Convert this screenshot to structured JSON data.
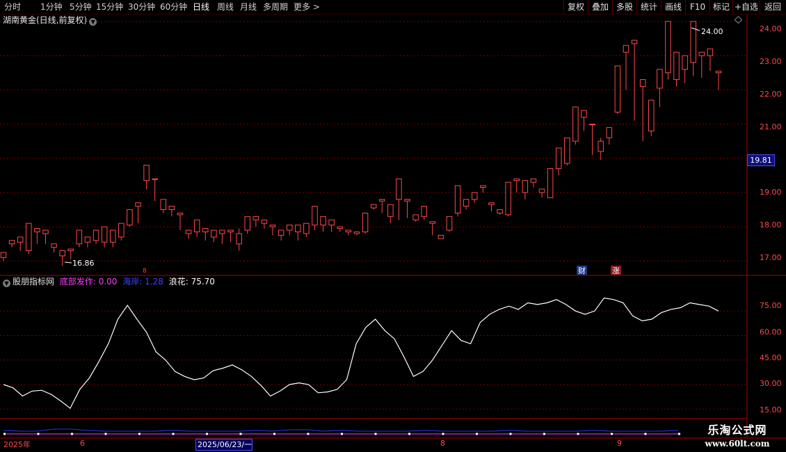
{
  "toolbar": {
    "periods": [
      "分时",
      "1分钟",
      "5分钟",
      "15分钟",
      "30分钟",
      "60分钟",
      "日线",
      "周线",
      "月线",
      "多周期",
      "更多 >"
    ],
    "active_period": "日线",
    "right_buttons": [
      "复权",
      "叠加",
      "多股",
      "统计",
      "画线",
      "F10",
      "标记",
      "+自选",
      "返回"
    ]
  },
  "main_chart": {
    "title": "湖南黄金(日线,前复权)",
    "title_icon": "chevron-down-icon",
    "high_label": "24.00",
    "low_label": "16.86",
    "current_price": "19.81",
    "price_ticks": [
      "24.00",
      "23.00",
      "22.00",
      "21.00",
      "19.00",
      "18.00",
      "17.00"
    ],
    "event_markers": [
      "财",
      "涨"
    ],
    "diamond_icon": "diamond-icon"
  },
  "indicator": {
    "name": "股朋指标网",
    "items": [
      {
        "label": "底部发作:",
        "value": "0.00",
        "color": "#ff40ff"
      },
      {
        "label": "海岸:",
        "value": "1.28",
        "color": "#4040ff"
      },
      {
        "label": "浪花:",
        "value": "75.70",
        "color": "#ffffff"
      }
    ],
    "ticks": [
      "75.00",
      "60.00",
      "45.00",
      "30.00",
      "15.00"
    ]
  },
  "date_axis": {
    "labels": [
      "2025年",
      "6",
      "8",
      "9"
    ],
    "cursor_label": "2025/06/23/一"
  },
  "watermark": {
    "line1": "乐淘公式网",
    "line2": "www.60lt.com"
  },
  "colors": {
    "up": "#ff4a4a",
    "down": "#54ffff",
    "grid": "#7a0000",
    "indicator_line": "#ffffff",
    "coast_line": "#3030ff"
  },
  "chart_data": {
    "type": "candlestick",
    "candles": [
      [
        17.1,
        17.25,
        17.0,
        17.0
      ],
      [
        17.5,
        17.6,
        17.4,
        17.55
      ],
      [
        17.55,
        17.7,
        17.3,
        17.3
      ],
      [
        17.3,
        18.1,
        17.2,
        18.0
      ],
      [
        17.85,
        17.95,
        17.5,
        17.6
      ],
      [
        17.8,
        17.9,
        17.5,
        17.55
      ],
      [
        17.4,
        17.5,
        17.25,
        17.5
      ],
      [
        17.15,
        17.3,
        16.86,
        17.1
      ],
      [
        17.3,
        17.35,
        17.05,
        17.1
      ],
      [
        17.5,
        17.9,
        17.4,
        17.6
      ],
      [
        17.55,
        17.7,
        17.4,
        17.6
      ],
      [
        17.6,
        17.9,
        17.5,
        17.55
      ],
      [
        17.55,
        18.0,
        17.4,
        17.8
      ],
      [
        17.55,
        17.9,
        17.4,
        17.7
      ],
      [
        17.7,
        18.1,
        17.6,
        18.05
      ],
      [
        18.05,
        18.5,
        18.0,
        18.4
      ],
      [
        18.6,
        18.7,
        18.1,
        18.65
      ],
      [
        19.35,
        19.8,
        19.1,
        19.4
      ],
      [
        19.4,
        19.4,
        18.75,
        18.8
      ],
      [
        18.5,
        18.8,
        18.4,
        18.5
      ],
      [
        18.5,
        18.6,
        18.3,
        18.5
      ],
      [
        18.35,
        18.4,
        17.9,
        18.0
      ],
      [
        17.8,
        17.9,
        17.65,
        17.9
      ],
      [
        17.85,
        18.2,
        17.7,
        18.05
      ],
      [
        17.85,
        17.95,
        17.6,
        17.65
      ],
      [
        17.7,
        17.9,
        17.55,
        17.75
      ],
      [
        17.8,
        17.9,
        17.5,
        17.85
      ],
      [
        17.85,
        17.9,
        17.55,
        17.6
      ],
      [
        17.5,
        17.8,
        17.3,
        17.95
      ],
      [
        17.9,
        18.3,
        17.8,
        18.25
      ],
      [
        18.2,
        18.3,
        18.0,
        18.1
      ],
      [
        18.1,
        18.2,
        17.95,
        18.2
      ],
      [
        18.0,
        18.05,
        17.75,
        17.9
      ],
      [
        17.75,
        17.9,
        17.6,
        17.9
      ],
      [
        17.9,
        18.05,
        17.75,
        18.0
      ],
      [
        17.85,
        18.05,
        17.6,
        17.6
      ],
      [
        17.8,
        18.1,
        17.7,
        18.1
      ],
      [
        18.05,
        18.6,
        17.9,
        18.45
      ],
      [
        18.05,
        18.3,
        17.85,
        18.2
      ],
      [
        18.05,
        18.2,
        17.85,
        18.1
      ],
      [
        17.95,
        18.0,
        17.85,
        17.9
      ],
      [
        17.85,
        17.9,
        17.75,
        17.8
      ],
      [
        17.8,
        17.85,
        17.75,
        17.85
      ],
      [
        17.85,
        18.4,
        17.8,
        18.3
      ],
      [
        18.55,
        18.65,
        18.5,
        18.6
      ],
      [
        18.75,
        18.8,
        18.4,
        18.5
      ],
      [
        18.3,
        18.65,
        18.1,
        18.55
      ],
      [
        18.8,
        19.4,
        18.2,
        18.9
      ],
      [
        18.75,
        18.8,
        18.25,
        18.3
      ],
      [
        18.2,
        18.35,
        18.15,
        18.3
      ],
      [
        18.3,
        18.6,
        18.2,
        18.3
      ],
      [
        18.1,
        18.15,
        17.75,
        17.8
      ],
      [
        17.65,
        17.75,
        17.65,
        17.7
      ],
      [
        17.9,
        18.3,
        17.85,
        18.2
      ],
      [
        18.4,
        19.2,
        18.3,
        18.5
      ],
      [
        18.6,
        18.8,
        18.5,
        18.75
      ],
      [
        18.8,
        19.0,
        18.7,
        18.95
      ],
      [
        19.15,
        19.2,
        19.0,
        19.05
      ],
      [
        18.65,
        18.7,
        18.45,
        18.45
      ],
      [
        18.4,
        18.5,
        18.35,
        18.35
      ],
      [
        18.35,
        19.3,
        18.3,
        19.25
      ],
      [
        19.35,
        19.4,
        19.0,
        19.05
      ],
      [
        19.0,
        19.35,
        18.8,
        19.3
      ],
      [
        19.3,
        19.4,
        19.15,
        19.15
      ],
      [
        19.0,
        19.1,
        18.85,
        18.95
      ],
      [
        18.85,
        19.7,
        18.85,
        19.7
      ],
      [
        19.7,
        20.3,
        19.5,
        20.1
      ],
      [
        19.85,
        20.6,
        19.8,
        20.05
      ],
      [
        20.5,
        21.5,
        20.4,
        21.1
      ],
      [
        21.2,
        21.4,
        20.8,
        21.0
      ],
      [
        21.0,
        21.0,
        20.1,
        20.2
      ],
      [
        20.2,
        20.5,
        19.95,
        20.6
      ],
      [
        20.6,
        20.9,
        20.4,
        20.7
      ],
      [
        21.35,
        22.7,
        21.3,
        22.7
      ],
      [
        23.1,
        23.3,
        22.0,
        22.3
      ],
      [
        23.35,
        23.45,
        21.1,
        21.1
      ],
      [
        22.1,
        22.3,
        20.5,
        20.8
      ],
      [
        20.8,
        21.7,
        20.65,
        21.6
      ],
      [
        22.05,
        22.6,
        21.5,
        22.05
      ],
      [
        22.5,
        24.0,
        22.3,
        23.2
      ],
      [
        22.3,
        23.1,
        22.1,
        22.7
      ],
      [
        22.6,
        23.0,
        22.2,
        22.85
      ],
      [
        22.8,
        24.0,
        22.4,
        23.4
      ],
      [
        23.0,
        23.1,
        22.35,
        22.6
      ],
      [
        23.0,
        23.2,
        22.55,
        22.85
      ],
      [
        22.5,
        22.55,
        22.0,
        22.2
      ]
    ],
    "high": 24.0,
    "low": 16.86,
    "ylim": [
      16.6,
      24.2
    ],
    "indicator_line": [
      30,
      28,
      23,
      26,
      26.5,
      24,
      20,
      15.5,
      27,
      34,
      44,
      55,
      70,
      78.5,
      70,
      62,
      50,
      45,
      38,
      35,
      33,
      34,
      38.5,
      40,
      42,
      39,
      35,
      29.5,
      23,
      26,
      30,
      31,
      30,
      25,
      25.5,
      27,
      33,
      55,
      65,
      70,
      63,
      58,
      47,
      35,
      38,
      45,
      54,
      63,
      57,
      55,
      68,
      73,
      76,
      78,
      76,
      80,
      79,
      80,
      82,
      79,
      75,
      73,
      75,
      83,
      82,
      80,
      72,
      69,
      70,
      74,
      76,
      77,
      80,
      79,
      78,
      75
    ],
    "indicator_ylim": [
      10,
      90
    ]
  }
}
